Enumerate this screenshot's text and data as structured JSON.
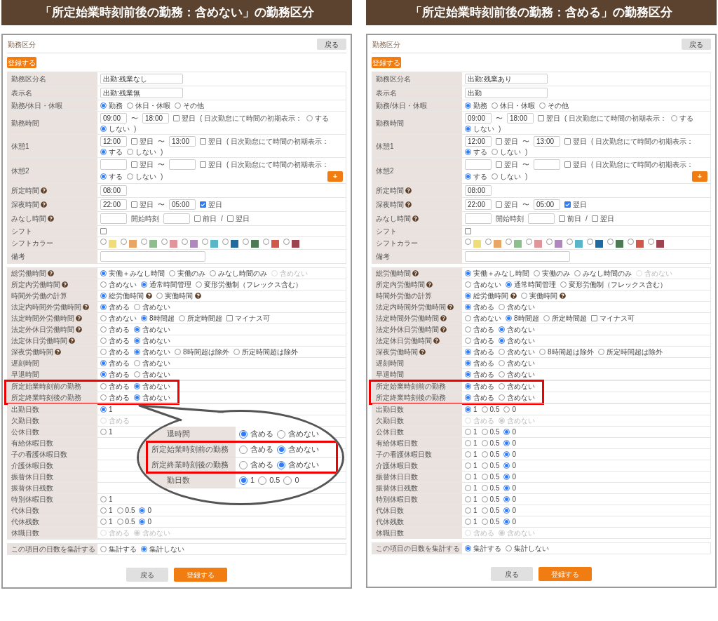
{
  "panels": [
    {
      "banner": "「所定始業時刻前後の勤務：含めない」の勤務区分",
      "title": "勤務区分",
      "header_button": "戻る",
      "register_button": "登録する",
      "settings_rows": [
        {
          "label": "勤務区分名",
          "parts": [
            {
              "kind": "name_field",
              "value": "出勤:残業なし"
            }
          ]
        },
        {
          "label": "表示名",
          "parts": [
            {
              "kind": "name_field",
              "value": "出勤:残業無"
            }
          ]
        },
        {
          "label": "勤務/休日・休暇",
          "parts": [
            {
              "kind": "radio",
              "label": "勤務",
              "selected": true
            },
            {
              "kind": "radio",
              "label": "休日・休暇",
              "selected": false
            },
            {
              "kind": "radio",
              "label": "その他",
              "selected": false
            }
          ]
        },
        {
          "label": "勤務時間",
          "parts": [
            {
              "kind": "time_field",
              "value": "09:00"
            },
            {
              "kind": "text",
              "text": "〜"
            },
            {
              "kind": "time_field",
              "value": "18:00"
            },
            {
              "kind": "checkbox",
              "label": "翌日",
              "checked": false
            },
            {
              "kind": "text",
              "text": "( 日次勤怠にて時間の初期表示："
            },
            {
              "kind": "radio",
              "label": "する",
              "selected": false
            },
            {
              "kind": "radio",
              "label": "しない",
              "selected": true
            },
            {
              "kind": "text",
              "text": ")"
            }
          ]
        },
        {
          "label": "休憩1",
          "parts": [
            {
              "kind": "time_field",
              "value": "12:00"
            },
            {
              "kind": "checkbox",
              "label": "翌日",
              "checked": false
            },
            {
              "kind": "text",
              "text": "〜"
            },
            {
              "kind": "time_field",
              "value": "13:00"
            },
            {
              "kind": "checkbox",
              "label": "翌日",
              "checked": false
            },
            {
              "kind": "text",
              "text": "( 日次勤怠にて時間の初期表示："
            },
            {
              "kind": "radio",
              "label": "する",
              "selected": true
            },
            {
              "kind": "radio",
              "label": "しない",
              "selected": false
            },
            {
              "kind": "text",
              "text": ")"
            }
          ]
        },
        {
          "label": "休憩2",
          "parts": [
            {
              "kind": "time_field"
            },
            {
              "kind": "checkbox",
              "label": "翌日",
              "checked": false
            },
            {
              "kind": "text",
              "text": "〜"
            },
            {
              "kind": "time_field"
            },
            {
              "kind": "checkbox",
              "label": "翌日",
              "checked": false
            },
            {
              "kind": "text",
              "text": "( 日次勤怠にて時間の初期表示："
            },
            {
              "kind": "radio",
              "label": "する",
              "selected": true
            },
            {
              "kind": "radio",
              "label": "しない",
              "selected": false
            },
            {
              "kind": "text",
              "text": ")"
            },
            {
              "kind": "add_button",
              "label": "+"
            }
          ]
        },
        {
          "label": "所定時間",
          "help": true,
          "parts": [
            {
              "kind": "time_field",
              "value": "08:00"
            }
          ]
        },
        {
          "label": "深夜時間",
          "help": true,
          "parts": [
            {
              "kind": "time_field",
              "value": "22:00"
            },
            {
              "kind": "checkbox",
              "label": "翌日",
              "checked": false
            },
            {
              "kind": "text",
              "text": "〜"
            },
            {
              "kind": "time_field",
              "value": "05:00"
            },
            {
              "kind": "checkbox",
              "label": "翌日",
              "checked": true
            }
          ]
        },
        {
          "label": "みなし時間",
          "help": true,
          "parts": [
            {
              "kind": "time_field"
            },
            {
              "kind": "text",
              "text": "開始時刻"
            },
            {
              "kind": "time_field"
            },
            {
              "kind": "checkbox",
              "label": "前日",
              "checked": false
            },
            {
              "kind": "text",
              "text": "/"
            },
            {
              "kind": "checkbox",
              "label": "翌日",
              "checked": false
            }
          ]
        },
        {
          "label": "シフト",
          "parts": [
            {
              "kind": "checkbox",
              "checked": false
            }
          ]
        },
        {
          "label": "シフトカラー",
          "parts": [
            {
              "kind": "swatch",
              "color": "#f0dc78",
              "selected": false
            },
            {
              "kind": "swatch",
              "color": "#e8a565",
              "selected": false
            },
            {
              "kind": "swatch",
              "color": "#8dbf8d",
              "selected": false
            },
            {
              "kind": "swatch",
              "color": "#e0959a",
              "selected": false
            },
            {
              "kind": "swatch",
              "color": "#b085c0",
              "selected": false
            },
            {
              "kind": "swatch",
              "color": "#5bb5c8",
              "selected": false
            },
            {
              "kind": "swatch",
              "color": "#1f6aa0",
              "selected": false
            },
            {
              "kind": "swatch",
              "color": "#4d7a55",
              "selected": false
            },
            {
              "kind": "swatch",
              "color": "#d0584a",
              "selected": false
            },
            {
              "kind": "swatch",
              "color": "#9c4450",
              "selected": false
            }
          ]
        },
        {
          "label": "備考",
          "parts": [
            {
              "kind": "memo_field"
            }
          ]
        }
      ],
      "calc_rows": [
        {
          "label": "総労働時間",
          "help": true,
          "parts": [
            {
              "kind": "radio",
              "label": "実働＋みなし時間",
              "selected": true,
              "disabled": false
            },
            {
              "kind": "radio",
              "label": "実働のみ",
              "selected": false,
              "disabled": false
            },
            {
              "kind": "radio",
              "label": "みなし時間のみ",
              "selected": false,
              "disabled": false
            },
            {
              "kind": "radio",
              "label": "含めない",
              "selected": false,
              "disabled": true
            }
          ]
        },
        {
          "label": "所定内労働時間",
          "help": true,
          "parts": [
            {
              "kind": "radio",
              "label": "含めない",
              "selected": false
            },
            {
              "kind": "radio",
              "label": "通常時間管理",
              "selected": true
            },
            {
              "kind": "radio",
              "label": "変形労働制（フレックス含む）",
              "selected": false
            }
          ]
        },
        {
          "label": "時間外労働の計算",
          "parts": [
            {
              "kind": "radio",
              "label": "総労働時間",
              "selected": true,
              "help": true
            },
            {
              "kind": "radio",
              "label": "実働時間",
              "selected": false,
              "help": true
            }
          ]
        },
        {
          "label": "法定内時間外労働時間",
          "help": true,
          "parts": [
            {
              "kind": "radio",
              "label": "含める",
              "selected": true
            },
            {
              "kind": "radio",
              "label": "含めない",
              "selected": false
            }
          ]
        },
        {
          "label": "法定時間外労働時間",
          "help": true,
          "parts": [
            {
              "kind": "radio",
              "label": "含めない",
              "selected": false
            },
            {
              "kind": "radio",
              "label": "8時間超",
              "selected": true
            },
            {
              "kind": "radio",
              "label": "所定時間超",
              "selected": false
            },
            {
              "kind": "checkbox",
              "label": "マイナス可",
              "checked": false
            }
          ]
        },
        {
          "label": "法定外休日労働時間",
          "help": true,
          "parts": [
            {
              "kind": "radio",
              "label": "含める",
              "selected": false
            },
            {
              "kind": "radio",
              "label": "含めない",
              "selected": true
            }
          ]
        },
        {
          "label": "法定休日労働時間",
          "help": true,
          "parts": [
            {
              "kind": "radio",
              "label": "含める",
              "selected": false
            },
            {
              "kind": "radio",
              "label": "含めない",
              "selected": true
            }
          ]
        },
        {
          "label": "深夜労働時間",
          "help": true,
          "parts": [
            {
              "kind": "radio",
              "label": "含める",
              "selected": false
            },
            {
              "kind": "radio",
              "label": "含めない",
              "selected": true
            },
            {
              "kind": "radio",
              "label": "8時間超は除外",
              "selected": false
            },
            {
              "kind": "radio",
              "label": "所定時間超は除外",
              "selected": false
            }
          ]
        },
        {
          "label": "遅刻時間",
          "parts": [
            {
              "kind": "radio",
              "label": "含める",
              "selected": true
            },
            {
              "kind": "radio",
              "label": "含めない",
              "selected": false
            }
          ]
        },
        {
          "label": "早退時間",
          "parts": [
            {
              "kind": "radio",
              "label": "含める",
              "selected": true
            },
            {
              "kind": "radio",
              "label": "含めない",
              "selected": false
            }
          ]
        }
      ],
      "highlighted_rows": [
        {
          "label": "所定始業時刻前の勤務",
          "parts": [
            {
              "kind": "radio",
              "label": "含める",
              "selected": false
            },
            {
              "kind": "radio",
              "label": "含めない",
              "selected": true
            }
          ]
        },
        {
          "label": "所定終業時刻後の勤務",
          "parts": [
            {
              "kind": "radio",
              "label": "含める",
              "selected": false
            },
            {
              "kind": "radio",
              "label": "含めない",
              "selected": true
            }
          ]
        }
      ],
      "day_rows": [
        {
          "label": "出勤日数",
          "parts": [
            {
              "kind": "radio",
              "label": "1",
              "selected": true
            }
          ]
        },
        {
          "label": "欠勤日数",
          "parts": [
            {
              "kind": "radio",
              "label": "含める",
              "selected": false,
              "disabled": true
            }
          ]
        },
        {
          "label": "公休日数",
          "parts": [
            {
              "kind": "radio",
              "label": "1",
              "selected": false
            }
          ]
        },
        {
          "label": "有給休暇日数",
          "parts": []
        },
        {
          "label": "子の看護休暇日数",
          "parts": []
        },
        {
          "label": "介護休暇日数",
          "parts": []
        },
        {
          "label": "振替休日日数",
          "parts": []
        },
        {
          "label": "振替休日残数",
          "parts": []
        },
        {
          "label": "特別休暇日数",
          "parts": [
            {
              "kind": "radio",
              "label": "1",
              "selected": false
            }
          ]
        },
        {
          "label": "代休日数",
          "parts": [
            {
              "kind": "radio",
              "label": "1",
              "selected": false
            },
            {
              "kind": "radio",
              "label": "0.5",
              "selected": false
            },
            {
              "kind": "radio",
              "label": "0",
              "selected": true
            }
          ]
        },
        {
          "label": "代休残数",
          "parts": [
            {
              "kind": "radio",
              "label": "1",
              "selected": false
            },
            {
              "kind": "radio",
              "label": "0.5",
              "selected": false
            },
            {
              "kind": "radio",
              "label": "0",
              "selected": true
            }
          ]
        },
        {
          "label": "休職日数",
          "parts": [
            {
              "kind": "radio",
              "label": "含める",
              "selected": false,
              "disabled": true
            },
            {
              "kind": "radio",
              "label": "含めない",
              "selected": true,
              "disabled": true
            }
          ]
        }
      ],
      "summary_rows": [
        {
          "label": "この項目の日数を集計する",
          "parts": [
            {
              "kind": "radio",
              "label": "集計する",
              "selected": false
            },
            {
              "kind": "radio",
              "label": "集計しない",
              "selected": true
            }
          ]
        }
      ],
      "callout": {
        "rows_above": [
          {
            "label": "退時間",
            "parts": [
              {
                "kind": "radio",
                "label": "含める",
                "selected": true
              },
              {
                "kind": "radio",
                "label": "含めない",
                "selected": false
              }
            ]
          }
        ],
        "highlighted_rows": [
          {
            "label": "所定始業時刻前の勤務",
            "parts": [
              {
                "kind": "radio",
                "label": "含める",
                "selected": false
              },
              {
                "kind": "radio",
                "label": "含めない",
                "selected": true
              }
            ]
          },
          {
            "label": "所定終業時刻後の勤務",
            "parts": [
              {
                "kind": "radio",
                "label": "含める",
                "selected": false
              },
              {
                "kind": "radio",
                "label": "含めない",
                "selected": true
              }
            ]
          }
        ],
        "rows_below": [
          {
            "label": "勤日数",
            "parts": [
              {
                "kind": "radio",
                "label": "1",
                "selected": true
              },
              {
                "kind": "radio",
                "label": "0.5",
                "selected": false
              },
              {
                "kind": "radio",
                "label": "0",
                "selected": false
              }
            ]
          }
        ]
      },
      "footer_buttons": [
        {
          "kind": "back",
          "label": "戻る"
        },
        {
          "kind": "register",
          "label": "登録する"
        }
      ]
    },
    {
      "banner": "「所定始業時刻前後の勤務：含める」の勤務区分",
      "title": "勤務区分",
      "header_button": "戻る",
      "register_button": "登録する",
      "settings_rows": [
        {
          "label": "勤務区分名",
          "parts": [
            {
              "kind": "name_field",
              "value": "出勤:残業あり"
            }
          ]
        },
        {
          "label": "表示名",
          "parts": [
            {
              "kind": "name_field",
              "value": "出勤"
            }
          ]
        },
        {
          "label": "勤務/休日・休暇",
          "parts": [
            {
              "kind": "radio",
              "label": "勤務",
              "selected": true
            },
            {
              "kind": "radio",
              "label": "休日・休暇",
              "selected": false
            },
            {
              "kind": "radio",
              "label": "その他",
              "selected": false
            }
          ]
        },
        {
          "label": "勤務時間",
          "parts": [
            {
              "kind": "time_field",
              "value": "09:00"
            },
            {
              "kind": "text",
              "text": "〜"
            },
            {
              "kind": "time_field",
              "value": "18:00"
            },
            {
              "kind": "checkbox",
              "label": "翌日",
              "checked": false
            },
            {
              "kind": "text",
              "text": "( 日次勤怠にて時間の初期表示："
            },
            {
              "kind": "radio",
              "label": "する",
              "selected": false
            },
            {
              "kind": "radio",
              "label": "しない",
              "selected": true
            },
            {
              "kind": "text",
              "text": ")"
            }
          ]
        },
        {
          "label": "休憩1",
          "parts": [
            {
              "kind": "time_field",
              "value": "12:00"
            },
            {
              "kind": "checkbox",
              "label": "翌日",
              "checked": false
            },
            {
              "kind": "text",
              "text": "〜"
            },
            {
              "kind": "time_field",
              "value": "13:00"
            },
            {
              "kind": "checkbox",
              "label": "翌日",
              "checked": false
            },
            {
              "kind": "text",
              "text": "( 日次勤怠にて時間の初期表示："
            },
            {
              "kind": "radio",
              "label": "する",
              "selected": true
            },
            {
              "kind": "radio",
              "label": "しない",
              "selected": false
            },
            {
              "kind": "text",
              "text": ")"
            }
          ]
        },
        {
          "label": "休憩2",
          "parts": [
            {
              "kind": "time_field"
            },
            {
              "kind": "checkbox",
              "label": "翌日",
              "checked": false
            },
            {
              "kind": "text",
              "text": "〜"
            },
            {
              "kind": "time_field"
            },
            {
              "kind": "checkbox",
              "label": "翌日",
              "checked": false
            },
            {
              "kind": "text",
              "text": "( 日次勤怠にて時間の初期表示："
            },
            {
              "kind": "radio",
              "label": "する",
              "selected": true
            },
            {
              "kind": "radio",
              "label": "しない",
              "selected": false
            },
            {
              "kind": "text",
              "text": ")"
            },
            {
              "kind": "add_button",
              "label": "+"
            }
          ]
        },
        {
          "label": "所定時間",
          "help": true,
          "parts": [
            {
              "kind": "time_field",
              "value": "08:00"
            }
          ]
        },
        {
          "label": "深夜時間",
          "help": true,
          "parts": [
            {
              "kind": "time_field",
              "value": "22:00"
            },
            {
              "kind": "checkbox",
              "label": "翌日",
              "checked": false
            },
            {
              "kind": "text",
              "text": "〜"
            },
            {
              "kind": "time_field",
              "value": "05:00"
            },
            {
              "kind": "checkbox",
              "label": "翌日",
              "checked": true
            }
          ]
        },
        {
          "label": "みなし時間",
          "help": true,
          "parts": [
            {
              "kind": "time_field"
            },
            {
              "kind": "text",
              "text": "開始時刻"
            },
            {
              "kind": "time_field"
            },
            {
              "kind": "checkbox",
              "label": "前日",
              "checked": false
            },
            {
              "kind": "text",
              "text": "/"
            },
            {
              "kind": "checkbox",
              "label": "翌日",
              "checked": false
            }
          ]
        },
        {
          "label": "シフト",
          "parts": [
            {
              "kind": "checkbox",
              "checked": false
            }
          ]
        },
        {
          "label": "シフトカラー",
          "parts": [
            {
              "kind": "swatch",
              "color": "#f0dc78",
              "selected": false
            },
            {
              "kind": "swatch",
              "color": "#e8a565",
              "selected": false
            },
            {
              "kind": "swatch",
              "color": "#8dbf8d",
              "selected": false
            },
            {
              "kind": "swatch",
              "color": "#e0959a",
              "selected": false
            },
            {
              "kind": "swatch",
              "color": "#b085c0",
              "selected": false
            },
            {
              "kind": "swatch",
              "color": "#5bb5c8",
              "selected": false
            },
            {
              "kind": "swatch",
              "color": "#1f6aa0",
              "selected": false
            },
            {
              "kind": "swatch",
              "color": "#4d7a55",
              "selected": false
            },
            {
              "kind": "swatch",
              "color": "#d0584a",
              "selected": false
            },
            {
              "kind": "swatch",
              "color": "#9c4450",
              "selected": false
            }
          ]
        },
        {
          "label": "備考",
          "parts": [
            {
              "kind": "memo_field"
            }
          ]
        }
      ],
      "calc_rows": [
        {
          "label": "総労働時間",
          "help": true,
          "parts": [
            {
              "kind": "radio",
              "label": "実働＋みなし時間",
              "selected": true,
              "disabled": false
            },
            {
              "kind": "radio",
              "label": "実働のみ",
              "selected": false,
              "disabled": false
            },
            {
              "kind": "radio",
              "label": "みなし時間のみ",
              "selected": false,
              "disabled": false
            },
            {
              "kind": "radio",
              "label": "含めない",
              "selected": false,
              "disabled": true
            }
          ]
        },
        {
          "label": "所定内労働時間",
          "help": true,
          "parts": [
            {
              "kind": "radio",
              "label": "含めない",
              "selected": false
            },
            {
              "kind": "radio",
              "label": "通常時間管理",
              "selected": true
            },
            {
              "kind": "radio",
              "label": "変形労働制（フレックス含む）",
              "selected": false
            }
          ]
        },
        {
          "label": "時間外労働の計算",
          "parts": [
            {
              "kind": "radio",
              "label": "総労働時間",
              "selected": true,
              "help": true
            },
            {
              "kind": "radio",
              "label": "実働時間",
              "selected": false,
              "help": true
            }
          ]
        },
        {
          "label": "法定内時間外労働時間",
          "help": true,
          "parts": [
            {
              "kind": "radio",
              "label": "含める",
              "selected": true
            },
            {
              "kind": "radio",
              "label": "含めない",
              "selected": false
            }
          ]
        },
        {
          "label": "法定時間外労働時間",
          "help": true,
          "parts": [
            {
              "kind": "radio",
              "label": "含めない",
              "selected": false
            },
            {
              "kind": "radio",
              "label": "8時間超",
              "selected": true
            },
            {
              "kind": "radio",
              "label": "所定時間超",
              "selected": false
            },
            {
              "kind": "checkbox",
              "label": "マイナス可",
              "checked": false
            }
          ]
        },
        {
          "label": "法定外休日労働時間",
          "help": true,
          "parts": [
            {
              "kind": "radio",
              "label": "含める",
              "selected": false
            },
            {
              "kind": "radio",
              "label": "含めない",
              "selected": true
            }
          ]
        },
        {
          "label": "法定休日労働時間",
          "help": true,
          "parts": [
            {
              "kind": "radio",
              "label": "含める",
              "selected": false
            },
            {
              "kind": "radio",
              "label": "含めない",
              "selected": true
            }
          ]
        },
        {
          "label": "深夜労働時間",
          "help": true,
          "parts": [
            {
              "kind": "radio",
              "label": "含める",
              "selected": true
            },
            {
              "kind": "radio",
              "label": "含めない",
              "selected": false
            },
            {
              "kind": "radio",
              "label": "8時間超は除外",
              "selected": false
            },
            {
              "kind": "radio",
              "label": "所定時間超は除外",
              "selected": false
            }
          ]
        },
        {
          "label": "遅刻時間",
          "parts": [
            {
              "kind": "radio",
              "label": "含める",
              "selected": true
            },
            {
              "kind": "radio",
              "label": "含めない",
              "selected": false
            }
          ]
        },
        {
          "label": "早退時間",
          "parts": [
            {
              "kind": "radio",
              "label": "含める",
              "selected": true
            },
            {
              "kind": "radio",
              "label": "含めない",
              "selected": false
            }
          ]
        }
      ],
      "highlighted_rows": [
        {
          "label": "所定始業時刻前の勤務",
          "parts": [
            {
              "kind": "radio",
              "label": "含める",
              "selected": true
            },
            {
              "kind": "radio",
              "label": "含めない",
              "selected": false
            }
          ]
        },
        {
          "label": "所定終業時刻後の勤務",
          "parts": [
            {
              "kind": "radio",
              "label": "含める",
              "selected": true
            },
            {
              "kind": "radio",
              "label": "含めない",
              "selected": false
            }
          ]
        }
      ],
      "day_rows": [
        {
          "label": "出勤日数",
          "parts": [
            {
              "kind": "radio",
              "label": "1",
              "selected": true
            },
            {
              "kind": "radio",
              "label": "0.5",
              "selected": false
            },
            {
              "kind": "radio",
              "label": "0",
              "selected": false
            }
          ]
        },
        {
          "label": "欠勤日数",
          "parts": [
            {
              "kind": "radio",
              "label": "含める",
              "selected": false,
              "disabled": true
            },
            {
              "kind": "radio",
              "label": "含めない",
              "selected": true,
              "disabled": true
            }
          ]
        },
        {
          "label": "公休日数",
          "parts": [
            {
              "kind": "radio",
              "label": "1",
              "selected": false
            },
            {
              "kind": "radio",
              "label": "0.5",
              "selected": false
            },
            {
              "kind": "radio",
              "label": "0",
              "selected": true
            }
          ]
        },
        {
          "label": "有給休暇日数",
          "parts": [
            {
              "kind": "radio",
              "label": "1",
              "selected": false
            },
            {
              "kind": "radio",
              "label": "0.5",
              "selected": false
            },
            {
              "kind": "radio",
              "label": "0",
              "selected": true
            }
          ]
        },
        {
          "label": "子の看護休暇日数",
          "parts": [
            {
              "kind": "radio",
              "label": "1",
              "selected": false
            },
            {
              "kind": "radio",
              "label": "0.5",
              "selected": false
            },
            {
              "kind": "radio",
              "label": "0",
              "selected": true
            }
          ]
        },
        {
          "label": "介護休暇日数",
          "parts": [
            {
              "kind": "radio",
              "label": "1",
              "selected": false
            },
            {
              "kind": "radio",
              "label": "0.5",
              "selected": false
            },
            {
              "kind": "radio",
              "label": "0",
              "selected": true
            }
          ]
        },
        {
          "label": "振替休日日数",
          "parts": [
            {
              "kind": "radio",
              "label": "1",
              "selected": false
            },
            {
              "kind": "radio",
              "label": "0.5",
              "selected": false
            },
            {
              "kind": "radio",
              "label": "0",
              "selected": true
            }
          ]
        },
        {
          "label": "振替休日残数",
          "parts": [
            {
              "kind": "radio",
              "label": "1",
              "selected": false
            },
            {
              "kind": "radio",
              "label": "0.5",
              "selected": false
            },
            {
              "kind": "radio",
              "label": "0",
              "selected": true
            }
          ]
        },
        {
          "label": "特別休暇日数",
          "parts": [
            {
              "kind": "radio",
              "label": "1",
              "selected": false
            },
            {
              "kind": "radio",
              "label": "0.5",
              "selected": false
            },
            {
              "kind": "radio",
              "label": "0",
              "selected": true
            }
          ]
        },
        {
          "label": "代休日数",
          "parts": [
            {
              "kind": "radio",
              "label": "1",
              "selected": false
            },
            {
              "kind": "radio",
              "label": "0.5",
              "selected": false
            },
            {
              "kind": "radio",
              "label": "0",
              "selected": true
            }
          ]
        },
        {
          "label": "代休残数",
          "parts": [
            {
              "kind": "radio",
              "label": "1",
              "selected": false
            },
            {
              "kind": "radio",
              "label": "0.5",
              "selected": false
            },
            {
              "kind": "radio",
              "label": "0",
              "selected": true
            }
          ]
        },
        {
          "label": "休職日数",
          "parts": [
            {
              "kind": "radio",
              "label": "含める",
              "selected": false,
              "disabled": true
            },
            {
              "kind": "radio",
              "label": "含めない",
              "selected": true,
              "disabled": true
            }
          ]
        }
      ],
      "summary_rows": [
        {
          "label": "この項目の日数を集計する",
          "parts": [
            {
              "kind": "radio",
              "label": "集計する",
              "selected": true
            },
            {
              "kind": "radio",
              "label": "集計しない",
              "selected": false
            }
          ]
        }
      ],
      "footer_buttons": [
        {
          "kind": "back",
          "label": "戻る"
        },
        {
          "kind": "register",
          "label": "登録する"
        }
      ]
    }
  ]
}
